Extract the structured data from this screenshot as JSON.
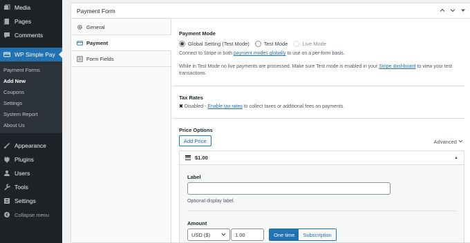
{
  "sidebar": {
    "items_top": [
      {
        "icon": "media-icon",
        "label": "Media"
      },
      {
        "icon": "pages-icon",
        "label": "Pages"
      },
      {
        "icon": "comments-icon",
        "label": "Comments"
      }
    ],
    "current": {
      "icon": "wp-simple-pay-icon",
      "label": "WP Simple Pay"
    },
    "submenu": [
      "Payment Forms",
      "Add New",
      "Coupons",
      "Settings",
      "System Report",
      "About Us"
    ],
    "submenu_active": "Add New",
    "items_bottom": [
      {
        "icon": "appearance-icon",
        "label": "Appearance"
      },
      {
        "icon": "plugins-icon",
        "label": "Plugins"
      },
      {
        "icon": "users-icon",
        "label": "Users"
      },
      {
        "icon": "tools-icon",
        "label": "Tools"
      },
      {
        "icon": "settings-icon",
        "label": "Settings"
      }
    ],
    "collapse": "Collapse menu"
  },
  "metabox": {
    "title": "Payment Form",
    "controls": [
      "chevron-up-icon",
      "chevron-down-icon",
      "toggle-arrow-icon"
    ]
  },
  "tabs": [
    {
      "icon": "gear-icon",
      "label": "General"
    },
    {
      "icon": "card-icon",
      "label": "Payment"
    },
    {
      "icon": "form-fields-icon",
      "label": "Form Fields"
    }
  ],
  "active_tab": "Payment",
  "payment_mode": {
    "title": "Payment Mode",
    "options": [
      "Global Setting (Test Mode)",
      "Test Mode",
      "Live Mode"
    ],
    "selected": "Global Setting (Test Mode)",
    "desc_before": "Connect to Stripe in both ",
    "desc_link": "payment modes globally",
    "desc_after": " to use on a per-form basis.",
    "note_before": "While in Test Mode no live payments are processed. Make sure Test mode is enabled in your ",
    "note_link": "Stripe dashboard",
    "note_after": " to view your test transactions."
  },
  "tax_rates": {
    "title": "Tax Rates",
    "status": "Disabled",
    "dash": " - ",
    "link": "Enable tax rates",
    "after": " to collect taxes or additional fees on payments."
  },
  "price_options": {
    "title": "Price Options",
    "add_button": "Add Price",
    "advanced": "Advanced",
    "price_label": "$1.00",
    "label_field": {
      "label": "Label",
      "value": "",
      "help": "Optional display label."
    },
    "amount": {
      "label": "Amount",
      "currency": "USD ($)",
      "value": "1.00",
      "types": [
        "One time",
        "Subscription"
      ],
      "selected_type": "One time"
    }
  },
  "colors": {
    "accent": "#2271b1",
    "sidebar": "#1d2327",
    "submenu": "#2c3338"
  }
}
